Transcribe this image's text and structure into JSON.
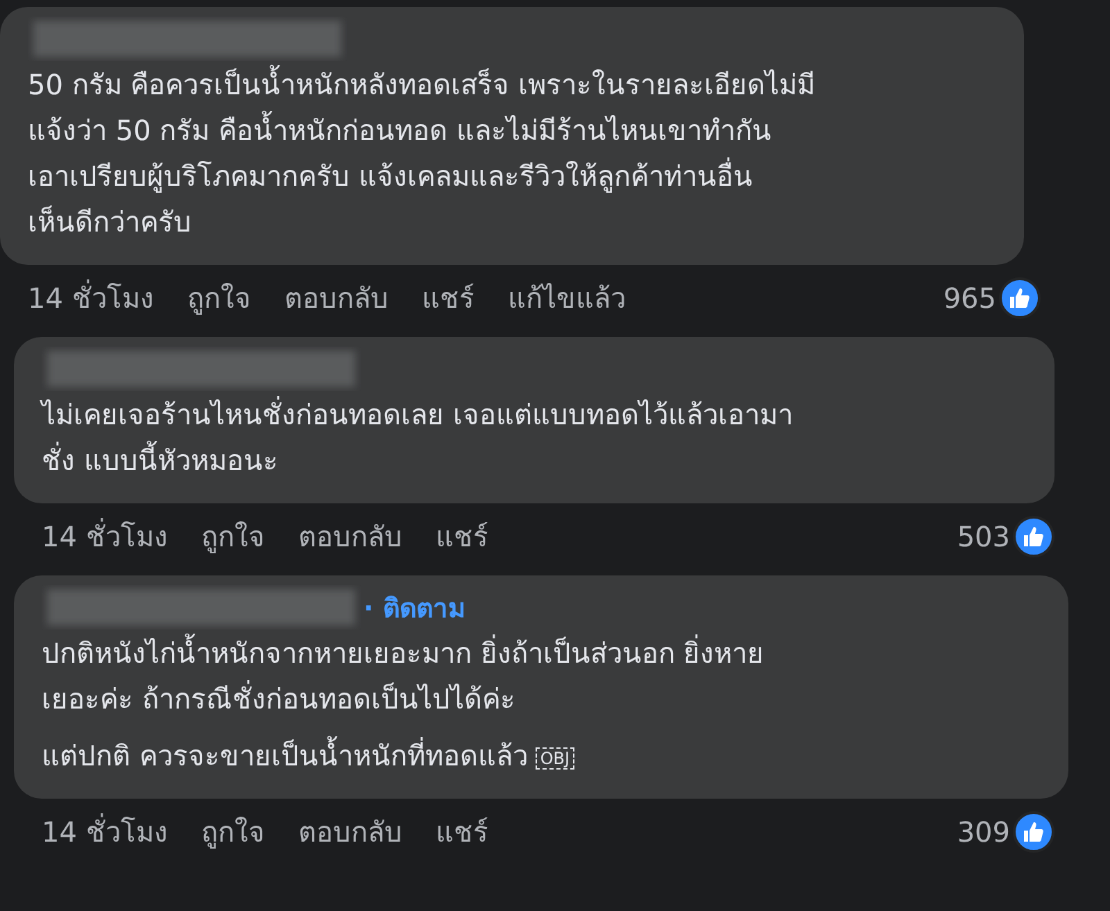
{
  "comments": [
    {
      "paragraphs": [
        [
          "50 กรัม คือควรเป็นน้ำหนักหลังทอดเสร็จ เพราะในรายละเอียดไม่มี",
          "แจ้งว่า 50 กรัม คือน้ำหนักก่อนทอด และไม่มีร้านไหนเขาทำกัน",
          "เอาเปรียบผู้บริโภคมากครับ แจ้งเคลมและรีวิวให้ลูกค้าท่านอื่น",
          "เห็นดีกว่าครับ"
        ]
      ],
      "time": "14 ชั่วโมง",
      "actions": [
        "ถูกใจ",
        "ตอบกลับ",
        "แชร์",
        "แก้ไขแล้ว"
      ],
      "reactions": "965"
    },
    {
      "paragraphs": [
        [
          "ไม่เคยเจอร้านไหนชั่งก่อนทอดเลย เจอแต่แบบทอดไว้แล้วเอามา",
          "ชั่ง แบบนี้หัวหมอนะ"
        ]
      ],
      "time": "14 ชั่วโมง",
      "actions": [
        "ถูกใจ",
        "ตอบกลับ",
        "แชร์"
      ],
      "reactions": "503"
    },
    {
      "follow": "· ติดตาม",
      "paragraphs": [
        [
          "ปกติหนังไก่น้ำหนักจากหายเยอะมาก ยิ่งถ้าเป็นส่วนอก ยิ่งหาย",
          "เยอะค่ะ ถ้ากรณีชั่งก่อนทอดเป็นไปได้ค่ะ"
        ],
        [
          "แต่ปกติ ควรจะขายเป็นน้ำหนักที่ทอดแล้ว"
        ]
      ],
      "object_marker": "OBJ",
      "time": "14 ชั่วโมง",
      "actions": [
        "ถูกใจ",
        "ตอบกลับ",
        "แชร์"
      ],
      "reactions": "309"
    }
  ]
}
